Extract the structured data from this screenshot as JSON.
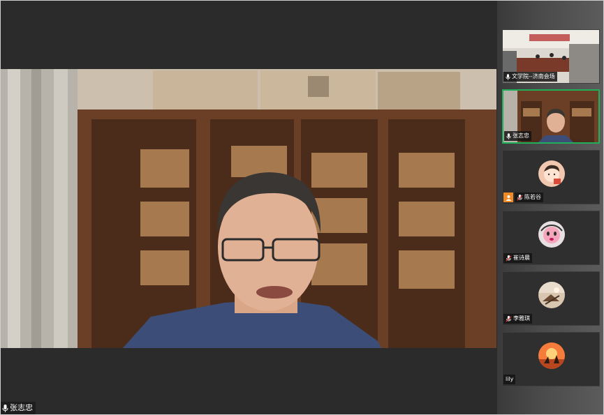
{
  "main": {
    "speaker_name": "张志忠"
  },
  "participants": [
    {
      "name": "文学院--济南会场",
      "icon": "microphone-icon",
      "active": false
    },
    {
      "name": "张志忠",
      "icon": "microphone-icon",
      "active": true
    },
    {
      "name": "陈若谷",
      "icon": "microphone-muted-icon",
      "host_badge": true
    },
    {
      "name": "崔诗晨",
      "icon": "microphone-muted-icon"
    },
    {
      "name": "李雅琪",
      "icon": "microphone-muted-icon"
    },
    {
      "name": "lily",
      "icon": ""
    }
  ],
  "colors": {
    "background": "#2b2b2b",
    "active_border": "#21b05a",
    "host_badge": "#f08a24"
  }
}
